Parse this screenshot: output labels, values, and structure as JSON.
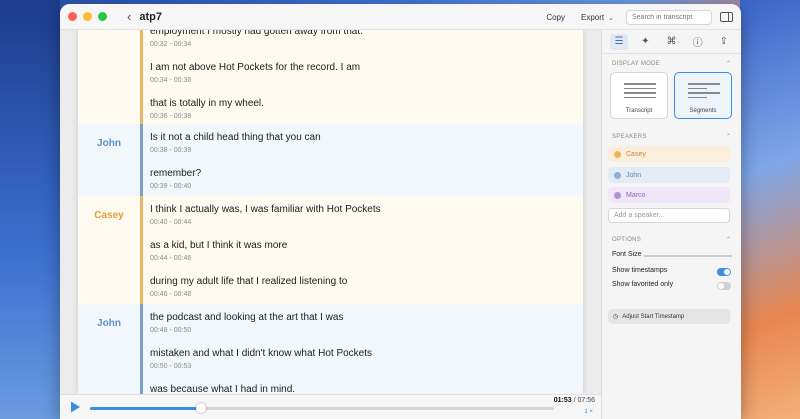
{
  "window": {
    "title": "atp7",
    "copy_label": "Copy",
    "export_label": "Export",
    "search_placeholder": "Search in transcript"
  },
  "transcript": {
    "blocks": [
      {
        "speaker": "",
        "segments": [
          {
            "text": "employment I mostly had gotten away from that.",
            "time": "00:32 - 00:34"
          },
          {
            "text": "I am not above Hot Pockets for the record. I am",
            "time": "00:34 - 00:36"
          },
          {
            "text": "that is totally in my wheel.",
            "time": "00:36 - 00:38"
          }
        ]
      },
      {
        "speaker": "John",
        "segments": [
          {
            "text": "Is it not a child head thing that you can",
            "time": "00:38 - 00:39"
          },
          {
            "text": "remember?",
            "time": "00:39 - 00:40"
          }
        ]
      },
      {
        "speaker": "Casey",
        "segments": [
          {
            "text": "I think I actually was, I was familiar with Hot Pockets",
            "time": "00:40 - 00:44"
          },
          {
            "text": "as a kid, but I think it was more",
            "time": "00:44 - 00:46"
          },
          {
            "text": "during my adult life that I realized listening to",
            "time": "00:46 - 00:48"
          }
        ]
      },
      {
        "speaker": "John",
        "segments": [
          {
            "text": "the podcast and looking at the art that I was",
            "time": "00:48 - 00:50"
          },
          {
            "text": "mistaken and what I didn't know what Hot Pockets",
            "time": "00:50 - 00:53"
          },
          {
            "text": "was because what I had in mind.",
            "time": ""
          }
        ]
      }
    ]
  },
  "player": {
    "current_time": "01:53",
    "total_time": "07:56",
    "progress": 0.24,
    "rate": "1 ×"
  },
  "sidebar": {
    "display_mode": {
      "heading": "DISPLAY MODE",
      "options": [
        "Transcript",
        "Segments"
      ],
      "selected": "Segments"
    },
    "speakers": {
      "heading": "SPEAKERS",
      "items": [
        {
          "name": "Casey",
          "color": "#f0b45a",
          "bg": "#fbeedd",
          "text_color": "#c98a28"
        },
        {
          "name": "John",
          "color": "#8ab0d8",
          "bg": "#e3ecf5",
          "text_color": "#5a88b8"
        },
        {
          "name": "Marco",
          "color": "#b38fd6",
          "bg": "#efe6f8",
          "text_color": "#8e62be"
        }
      ],
      "add_placeholder": "Add a speaker..."
    },
    "options": {
      "heading": "OPTIONS",
      "font_size_label": "Font Size",
      "show_timestamps_label": "Show timestamps",
      "show_timestamps": true,
      "show_favorited_label": "Show favorited only",
      "show_favorited": false
    },
    "adjust_label": "Adjust Start Timestamp"
  }
}
